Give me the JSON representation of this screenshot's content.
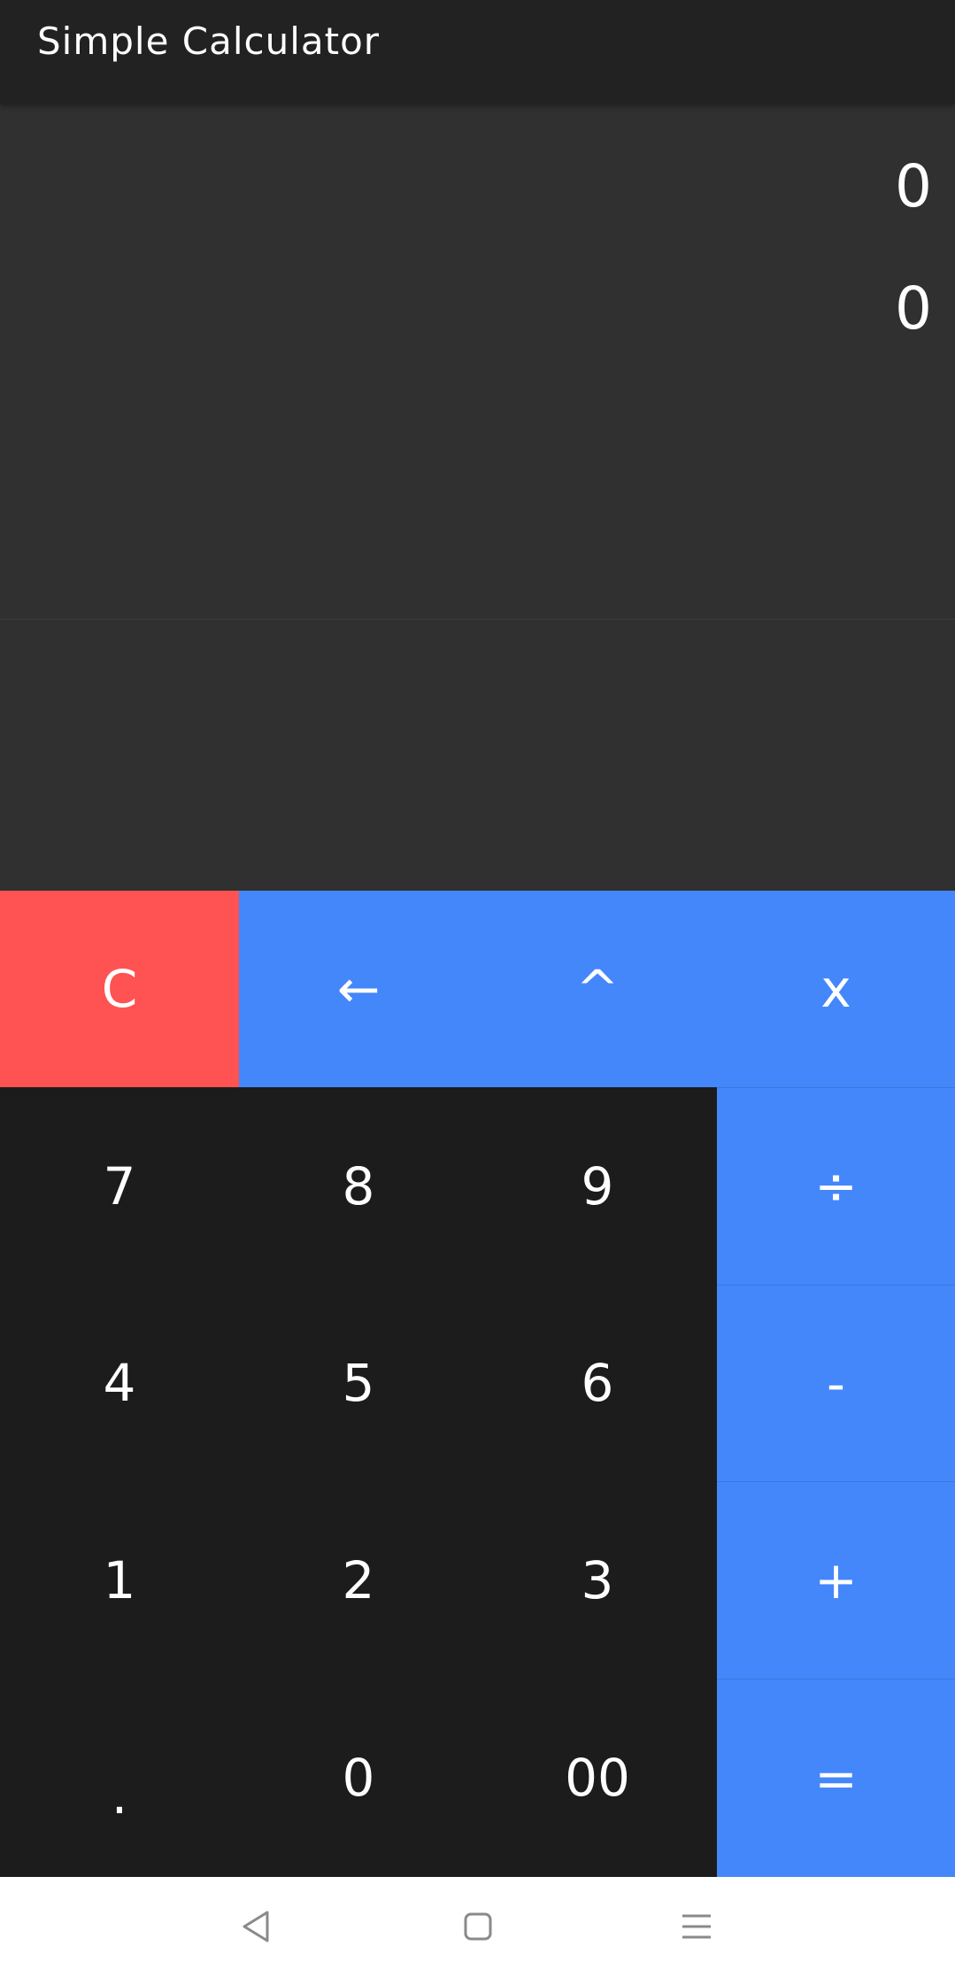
{
  "app": {
    "title": "Simple Calculator"
  },
  "display": {
    "expression": "0",
    "result": "0"
  },
  "keys": {
    "clear": "C",
    "backspace": "←",
    "power": "^",
    "multiply": "x",
    "divide": "÷",
    "subtract": "-",
    "add": "+",
    "equals": "=",
    "seven": "7",
    "eight": "8",
    "nine": "9",
    "four": "4",
    "five": "5",
    "six": "6",
    "one": "1",
    "two": "2",
    "three": "3",
    "decimal": ".",
    "zero": "0",
    "double_zero": "00"
  },
  "colors": {
    "operator_blue": "#4487fb",
    "clear_red": "#ff5252",
    "digit_bg": "#1c1c1c",
    "display_bg": "#303030",
    "app_bar_bg": "#222222"
  },
  "nav": {
    "back_icon": "back-triangle-icon",
    "home_icon": "home-square-icon",
    "menu_icon": "menu-lines-icon"
  }
}
